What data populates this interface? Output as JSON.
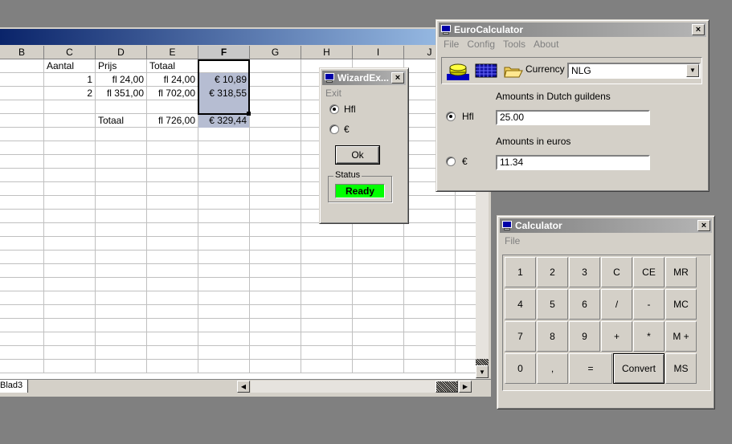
{
  "spreadsheet": {
    "columns": [
      "B",
      "C",
      "D",
      "E",
      "F",
      "G",
      "H",
      "I",
      "J"
    ],
    "active_column": "F",
    "rows": [
      {
        "C": "Aantal",
        "D": "Prijs",
        "E": "Totaal",
        "F": ""
      },
      {
        "C": "1",
        "D": "fl 24,00",
        "E": "fl 24,00",
        "F": "€ 10,89"
      },
      {
        "C": "2",
        "D": "fl 351,00",
        "E": "fl 702,00",
        "F": "€ 318,55"
      },
      {
        "C": "",
        "D": "",
        "E": "",
        "F": ""
      },
      {
        "C": "",
        "D": "Totaal",
        "E": "fl 726,00",
        "F": "€ 329,44"
      }
    ],
    "sheet_tab": "Blad3"
  },
  "wizard": {
    "title": "WizardEx...",
    "close": "×",
    "menu_exit": "Exit",
    "radio_hfl": "Hfl",
    "radio_euro": "€",
    "radio_selected": "hfl",
    "ok_label": "Ok",
    "status_group": "Status",
    "status_value": "Ready",
    "status_color": "#00ff00"
  },
  "euro_calculator": {
    "title": "EuroCalculator",
    "close": "×",
    "menu": [
      "File",
      "Config",
      "Tools",
      "About"
    ],
    "toolbar_icons": [
      "coin-stack-icon",
      "calculator-grid-icon",
      "folder-icon"
    ],
    "currency_label": "Currency :",
    "currency_value": "NLG",
    "guilders_label": "Amounts in Dutch guildens",
    "hfl_radio_label": "Hfl",
    "hfl_value": "25.00",
    "euros_label": "Amounts in euros",
    "euro_radio_label": "€",
    "euro_value": "11.34",
    "radio_selected": "hfl"
  },
  "calculator": {
    "title": "Calculator",
    "close": "×",
    "menu_file": "File",
    "keys": [
      [
        "1",
        "2",
        "3",
        "C",
        "CE",
        "MR"
      ],
      [
        "4",
        "5",
        "6",
        "/",
        "-",
        "MC"
      ],
      [
        "7",
        "8",
        "9",
        "+",
        "*",
        "M +"
      ],
      [
        "0",
        ",",
        "=",
        "Convert",
        "MS"
      ]
    ]
  }
}
